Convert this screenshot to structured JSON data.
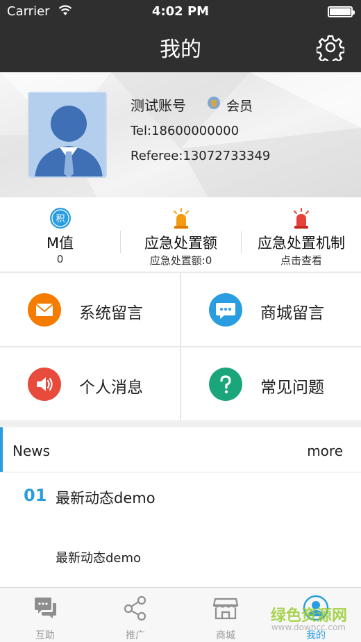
{
  "status_bar": {
    "carrier": "Carrier",
    "time": "4:02 PM"
  },
  "navbar": {
    "title": "我的",
    "settings_icon": "gear-icon"
  },
  "profile": {
    "name": "测试账号",
    "badge_label": "会员",
    "tel": "Tel:18600000000",
    "referee": "Referee:13072733349"
  },
  "stats": [
    {
      "icon": "积",
      "label": "M值",
      "sub": "0"
    },
    {
      "label": "应急处置额",
      "sub": "应急处置额:0"
    },
    {
      "label": "应急处置机制",
      "sub": "点击查看"
    }
  ],
  "menu": [
    {
      "label": "系统留言",
      "icon": "mail-icon",
      "color": "#f57c00"
    },
    {
      "label": "商城留言",
      "icon": "chat-icon",
      "color": "#2a9de0"
    },
    {
      "label": "个人消息",
      "icon": "speaker-icon",
      "color": "#e84a3c"
    },
    {
      "label": "常见问题",
      "icon": "question-icon",
      "color": "#1aa67a"
    }
  ],
  "news": {
    "header": "News",
    "more": "more",
    "items": [
      {
        "num": "01",
        "title": "最新动态demo",
        "desc": "最新动态demo"
      }
    ]
  },
  "tabs": [
    {
      "label": "互助"
    },
    {
      "label": "推广"
    },
    {
      "label": "商城"
    },
    {
      "label": "我的"
    }
  ],
  "watermark": {
    "text": "绿色资源网",
    "url": "www.downcc.com"
  },
  "colors": {
    "accent": "#2a9de0",
    "topbar": "#2f2f2f"
  }
}
